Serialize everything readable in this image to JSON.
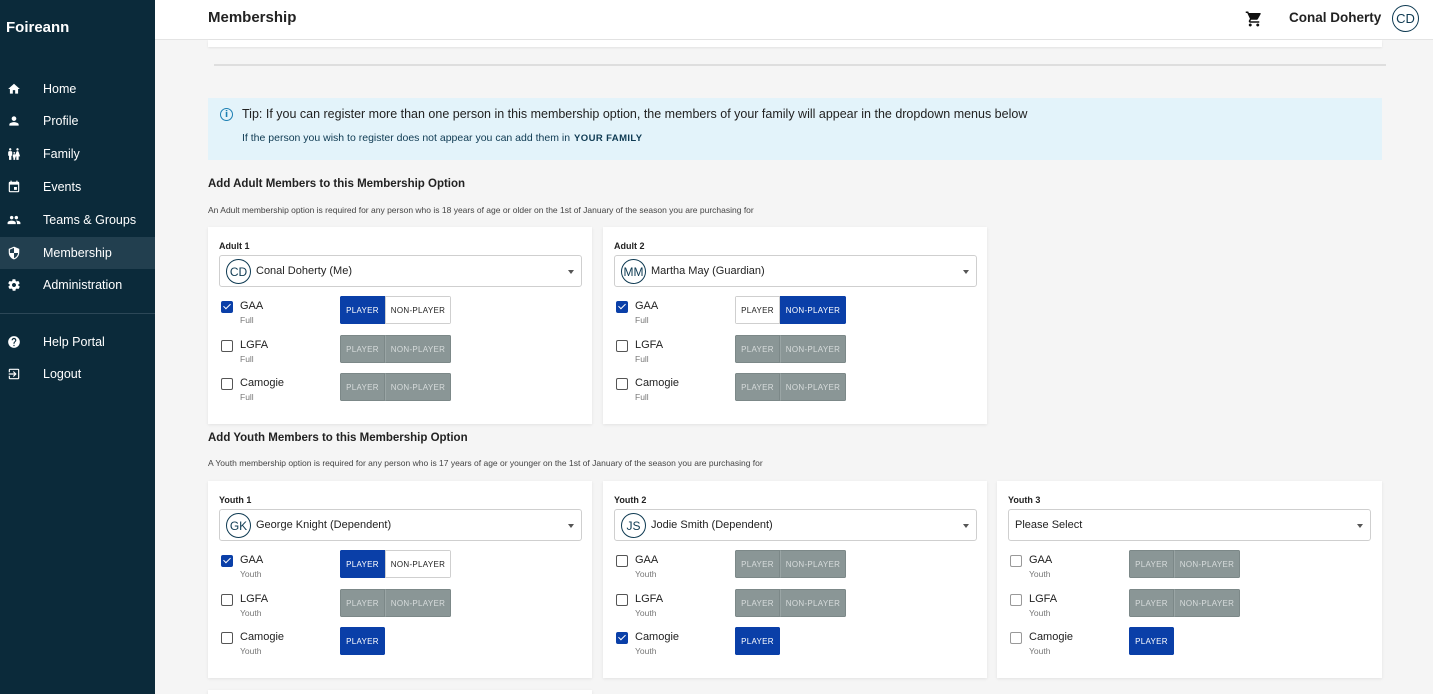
{
  "app": {
    "brand": "Foireann"
  },
  "nav": {
    "items": [
      {
        "label": "Home",
        "icon": "home-icon"
      },
      {
        "label": "Profile",
        "icon": "person-icon"
      },
      {
        "label": "Family",
        "icon": "family-icon"
      },
      {
        "label": "Events",
        "icon": "calendar-icon"
      },
      {
        "label": "Teams & Groups",
        "icon": "group-icon"
      },
      {
        "label": "Membership",
        "icon": "shield-icon",
        "active": true
      },
      {
        "label": "Administration",
        "icon": "gear-icon"
      }
    ],
    "secondary": [
      {
        "label": "Help Portal",
        "icon": "help-icon"
      },
      {
        "label": "Logout",
        "icon": "logout-icon"
      }
    ]
  },
  "header": {
    "title": "Membership",
    "user_name": "Conal Doherty",
    "user_initials": "CD"
  },
  "tip": {
    "icon": "i",
    "text": "Tip: If you can register more than one person in this membership option, the members of your family will appear in the dropdown menus below",
    "sub": "If the person you wish to register does not appear you can add them in",
    "link": "YOUR FAMILY"
  },
  "buttons": {
    "player": "PLAYER",
    "non_player": "NON-PLAYER"
  },
  "adult": {
    "title": "Add Adult Members to this Membership Option",
    "desc": "An Adult membership option is required for any person who is 18 years of age or older on the 1st of January of the season you are purchasing for",
    "cards": [
      {
        "label": "Adult 1",
        "initials": "CD",
        "person": "Conal Doherty (Me)",
        "rows": [
          {
            "name": "GAA",
            "sub": "Full",
            "checked": true
          },
          {
            "name": "LGFA",
            "sub": "Full",
            "checked": false
          },
          {
            "name": "Camogie",
            "sub": "Full",
            "checked": false
          }
        ]
      },
      {
        "label": "Adult 2",
        "initials": "MM",
        "person": "Martha May (Guardian)",
        "rows": [
          {
            "name": "GAA",
            "sub": "Full",
            "checked": true
          },
          {
            "name": "LGFA",
            "sub": "Full",
            "checked": false
          },
          {
            "name": "Camogie",
            "sub": "Full",
            "checked": false
          }
        ]
      }
    ]
  },
  "youth": {
    "title": "Add Youth Members to this Membership Option",
    "desc": "A Youth membership option is required for any person who is 17 years of age or younger on the 1st of January of the season you are purchasing for",
    "cards": [
      {
        "label": "Youth 1",
        "initials": "GK",
        "person": "George Knight (Dependent)",
        "rows": [
          {
            "name": "GAA",
            "sub": "Youth",
            "checked": true
          },
          {
            "name": "LGFA",
            "sub": "Youth",
            "checked": false
          },
          {
            "name": "Camogie",
            "sub": "Youth",
            "checked": false
          }
        ]
      },
      {
        "label": "Youth 2",
        "initials": "JS",
        "person": "Jodie Smith (Dependent)",
        "rows": [
          {
            "name": "GAA",
            "sub": "Youth",
            "checked": false
          },
          {
            "name": "LGFA",
            "sub": "Youth",
            "checked": false
          },
          {
            "name": "Camogie",
            "sub": "Youth",
            "checked": true
          }
        ]
      },
      {
        "label": "Youth 3",
        "initials": "",
        "person": "Please Select",
        "rows": [
          {
            "name": "GAA",
            "sub": "Youth",
            "checked": false
          },
          {
            "name": "LGFA",
            "sub": "Youth",
            "checked": false
          },
          {
            "name": "Camogie",
            "sub": "Youth",
            "checked": false
          }
        ]
      }
    ]
  }
}
